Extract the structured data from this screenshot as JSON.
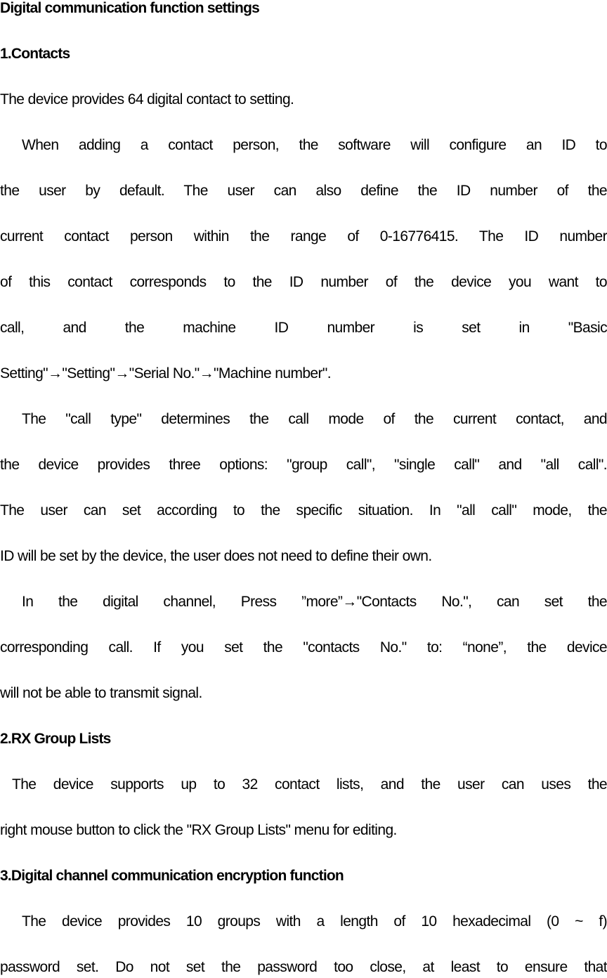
{
  "document": {
    "title": "Digital communication function settings",
    "sections": [
      {
        "heading": "1.Contacts",
        "lines": [
          "The device provides 64 digital contact to setting.",
          "When adding a contact person, the software will configure an ID to",
          "the user by default. The user can also define the ID number of the",
          "current contact person within the range of 0-16776415. The ID number",
          "of this contact corresponds to the ID number of the device you want to",
          "call, and the machine ID number is set in \"Basic",
          "Setting\"→\"Setting\"→\"Serial No.\"→\"Machine number\".",
          "The \"call type\" determines the call mode of the current contact, and",
          "the device provides three options: \"group call\", \"single call\" and \"all call\".",
          "The user can set according to the specific situation. In \"all call\" mode, the",
          "ID will be set by the device, the user does not need to define their own.",
          "In the digital channel, Press ”more”→\"Contacts No.\", can set the",
          "corresponding call. If you set the \"contacts No.\" to: “none”, the device",
          "will not be able to transmit signal."
        ]
      },
      {
        "heading": "2.RX Group Lists",
        "lines": [
          "The device supports up to 32 contact lists, and the user can uses the",
          "right mouse button to click the \"RX Group Lists\" menu for editing."
        ]
      },
      {
        "heading": "3.Digital channel communication encryption function",
        "lines": [
          "The device provides 10 groups with a length of 10 hexadecimal (0 ~ f)",
          "password set. Do not set the password too close, at least to ensure that"
        ]
      }
    ]
  }
}
